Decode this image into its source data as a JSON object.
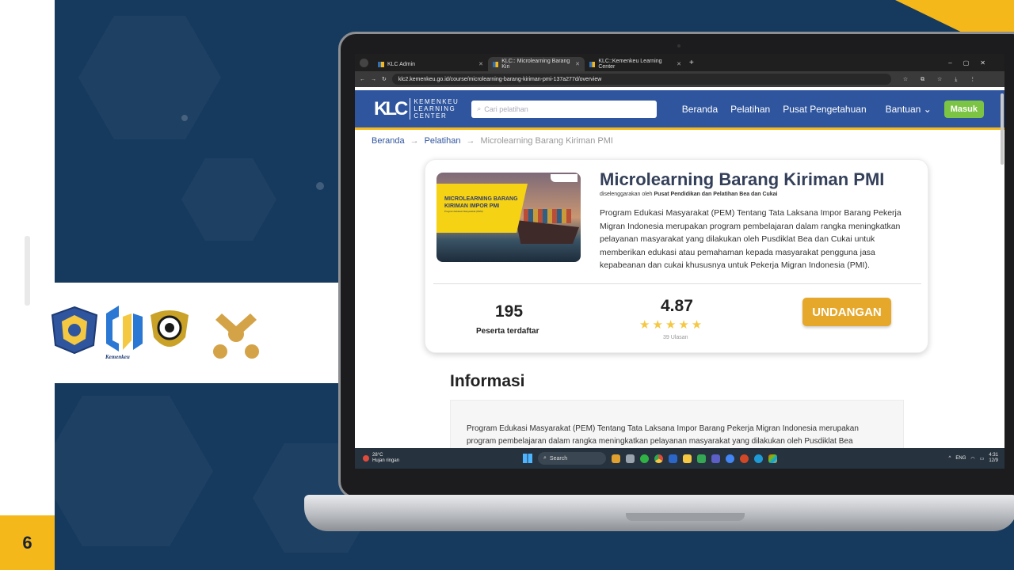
{
  "slide": {
    "page_number": "6"
  },
  "browser": {
    "tabs": [
      {
        "label": "KLC Admin"
      },
      {
        "label": "KLC:: Microlearning Barang Kiri"
      },
      {
        "label": "KLC::Kemenkeu Learning Center"
      }
    ],
    "url": "klc2.kemenkeu.go.id/course/microlearning-barang-kiriman-pmi-137a277d/overview"
  },
  "site": {
    "logo_mark": "KLC",
    "logo_text_lines": [
      "KEMENKEU",
      "LEARNING",
      "CENTER"
    ],
    "search_placeholder": "Cari pelatihan",
    "nav": {
      "home": "Beranda",
      "courses": "Pelatihan",
      "knowledge": "Pusat Pengetahuan",
      "help": "Bantuan",
      "login": "Masuk"
    }
  },
  "breadcrumb": {
    "items": [
      "Beranda",
      "Pelatihan",
      "Microlearning Barang Kiriman PMI"
    ]
  },
  "course": {
    "thumb_title": "MICROLEARNING BARANG KIRIMAN IMPOR PMI",
    "thumb_subtitle": "Program Edukasi Masyarakat (PEM)",
    "title": "Microlearning Barang Kiriman PMI",
    "organizer_prefix": "diselenggarakan oleh",
    "organizer": "Pusat Pendidikan dan Pelatihan Bea dan Cukai",
    "description": "Program Edukasi Masyarakat (PEM) Tentang Tata Laksana Impor Barang Pekerja Migran Indonesia merupakan program pembelajaran dalam rangka meningkatkan pelayanan masyarakat yang dilakukan oleh Pusdiklat Bea dan Cukai untuk memberikan edukasi atau pemahaman kepada masyarakat pengguna jasa kepabeanan dan cukai khususnya untuk Pekerja Migran Indonesia (PMI).",
    "participants_count": "195",
    "participants_label": "Peserta terdaftar",
    "rating": "4.87",
    "rating_stars": 5,
    "reviews": "39 Ulasan",
    "invite_label": "UNDANGAN"
  },
  "info": {
    "heading": "Informasi",
    "text": "Program Edukasi Masyarakat (PEM) Tentang Tata Laksana Impor Barang Pekerja Migran Indonesia merupakan program pembelajaran dalam rangka meningkatkan pelayanan masyarakat yang dilakukan oleh Pusdiklat Bea"
  },
  "taskbar": {
    "weather_temp": "28°C",
    "weather_desc": "Hujan ringan",
    "search_label": "Search",
    "lang": "ENG",
    "time": "4:31",
    "date": "12/9"
  },
  "colors": {
    "accent": "#f5b81a",
    "slide_bg": "#163a5e",
    "site_header": "#2f559e",
    "invite": "#e6a82b",
    "login": "#7cc444"
  }
}
